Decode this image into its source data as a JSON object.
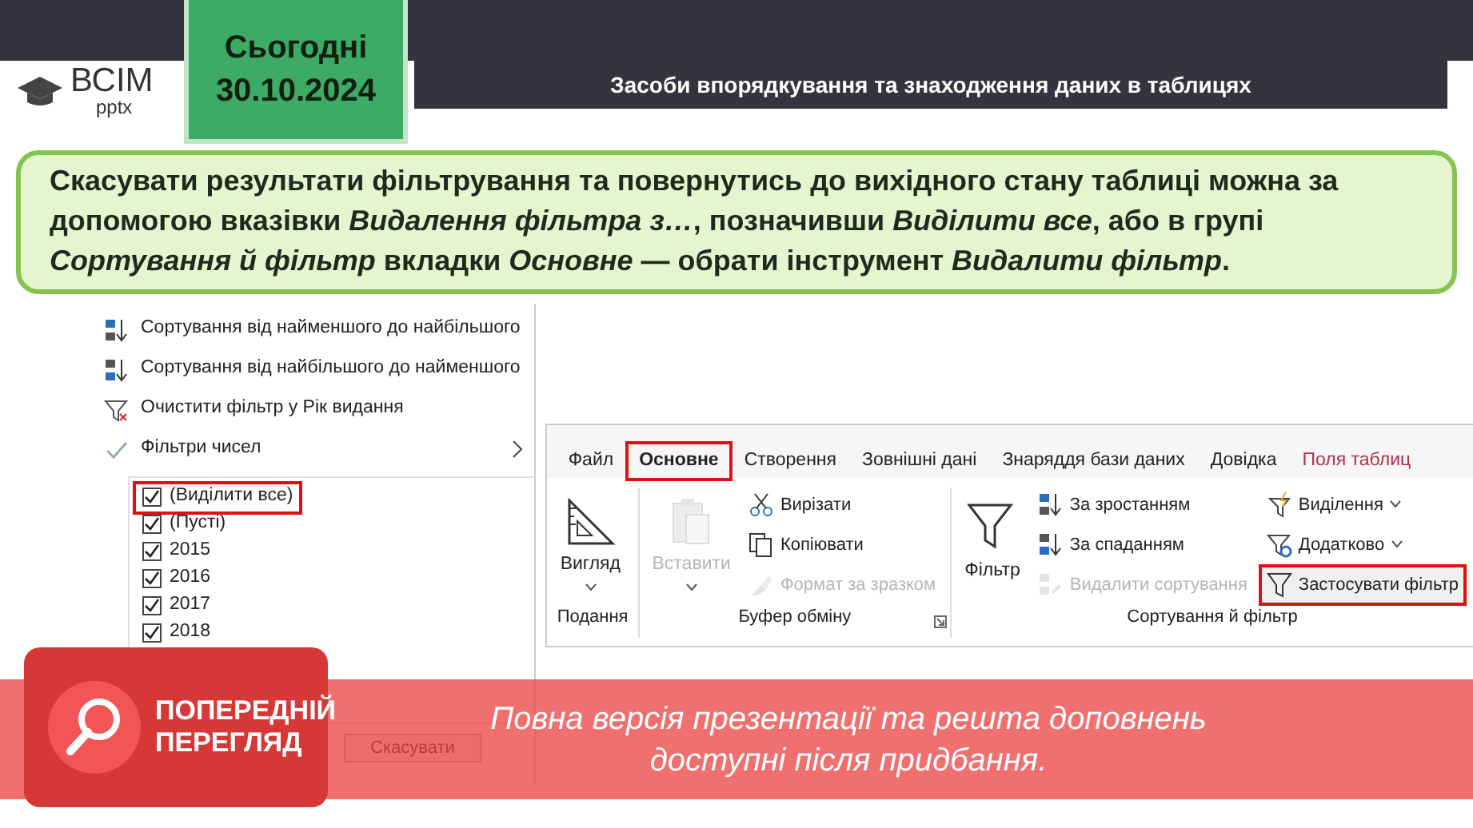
{
  "slide": {
    "logo": {
      "text": "ВСІМ",
      "subtext": "pptx"
    },
    "date": {
      "label": "Сьогодні",
      "value": "30.10.2024"
    },
    "title": "Засоби впорядкування та знаходження даних в таблицях",
    "note": "Скасувати результати фільтрування та повернутись до вихідного стану таблиці можна за допомогою вказівки *Видалення фільтра з…*, позначивши *Виділити все*, або в групі *Сортування й фільтр* вкладки *Основне* — обрати інструмент *Видалити фільтр*."
  },
  "filter_menu": {
    "items": [
      {
        "kind": "sort-asc",
        "label": "Сортування від найменшого до найбільшого"
      },
      {
        "kind": "sort-desc",
        "label": "Сортування від найбільшого до найменшого"
      },
      {
        "kind": "clear",
        "label": "Очистити фільтр у Рік видання"
      },
      {
        "kind": "submenu",
        "label": "Фільтри чисел"
      }
    ],
    "values": [
      {
        "label": "(Виділити все)",
        "checked": true,
        "highlighted": true
      },
      {
        "label": "(Пусті)",
        "checked": true,
        "highlighted": false
      },
      {
        "label": "2015",
        "checked": true,
        "highlighted": false
      },
      {
        "label": "2016",
        "checked": true,
        "highlighted": false
      },
      {
        "label": "2017",
        "checked": true,
        "highlighted": false
      },
      {
        "label": "2018",
        "checked": true,
        "highlighted": false
      }
    ],
    "cancel_button": "Скасувати"
  },
  "ribbon": {
    "tabs": [
      {
        "label": "Файл",
        "selected": false,
        "highlighted": false,
        "kind": "normal"
      },
      {
        "label": "Основне",
        "selected": true,
        "highlighted": true,
        "kind": "normal"
      },
      {
        "label": "Створення",
        "selected": false,
        "highlighted": false,
        "kind": "normal"
      },
      {
        "label": "Зовнішні дані",
        "selected": false,
        "highlighted": false,
        "kind": "normal"
      },
      {
        "label": "Знаряддя бази даних",
        "selected": false,
        "highlighted": false,
        "kind": "normal"
      },
      {
        "label": "Довідка",
        "selected": false,
        "highlighted": false,
        "kind": "normal"
      },
      {
        "label": "Поля таблиц",
        "selected": false,
        "highlighted": false,
        "kind": "contextual"
      }
    ],
    "groups": [
      {
        "label": "Подання",
        "launcher": false,
        "columns": [
          [
            {
              "kind": "big",
              "label": "Вигляд",
              "dropdown": true,
              "disabled": false,
              "highlighted": false
            }
          ]
        ]
      },
      {
        "label": "Буфер обміну",
        "launcher": true,
        "columns": [
          [
            {
              "kind": "big",
              "label": "Вставити",
              "dropdown": true,
              "disabled": true,
              "highlighted": false
            }
          ],
          [
            {
              "kind": "small",
              "label": "Вирізати",
              "dropdown": false,
              "disabled": false,
              "highlighted": false
            },
            {
              "kind": "small",
              "label": "Копіювати",
              "dropdown": false,
              "disabled": false,
              "highlighted": false
            },
            {
              "kind": "small",
              "label": "Формат за зразком",
              "dropdown": false,
              "disabled": true,
              "highlighted": false
            }
          ]
        ]
      },
      {
        "label": "Сортування й фільтр",
        "launcher": false,
        "columns": [
          [
            {
              "kind": "big",
              "label": "Фільтр",
              "dropdown": false,
              "disabled": false,
              "highlighted": false
            }
          ],
          [
            {
              "kind": "small",
              "label": "За зростанням",
              "dropdown": false,
              "disabled": false,
              "highlighted": false
            },
            {
              "kind": "small",
              "label": "За спаданням",
              "dropdown": false,
              "disabled": false,
              "highlighted": false
            },
            {
              "kind": "small",
              "label": "Видалити сортування",
              "dropdown": false,
              "disabled": true,
              "highlighted": false
            }
          ],
          [
            {
              "kind": "small",
              "label": "Виділення",
              "dropdown": true,
              "disabled": false,
              "highlighted": false
            },
            {
              "kind": "small",
              "label": "Додатково",
              "dropdown": true,
              "disabled": false,
              "highlighted": false
            },
            {
              "kind": "small",
              "label": "Застосувати фільтр",
              "dropdown": false,
              "disabled": false,
              "highlighted": true
            }
          ]
        ]
      }
    ]
  },
  "preview_banner": {
    "badge_lines": [
      "ПОПЕРЕДНІЙ",
      "ПЕРЕГЛЯД"
    ],
    "message_lines": [
      "Повна версія презентації та решта доповнень",
      "доступні після придбання."
    ]
  }
}
